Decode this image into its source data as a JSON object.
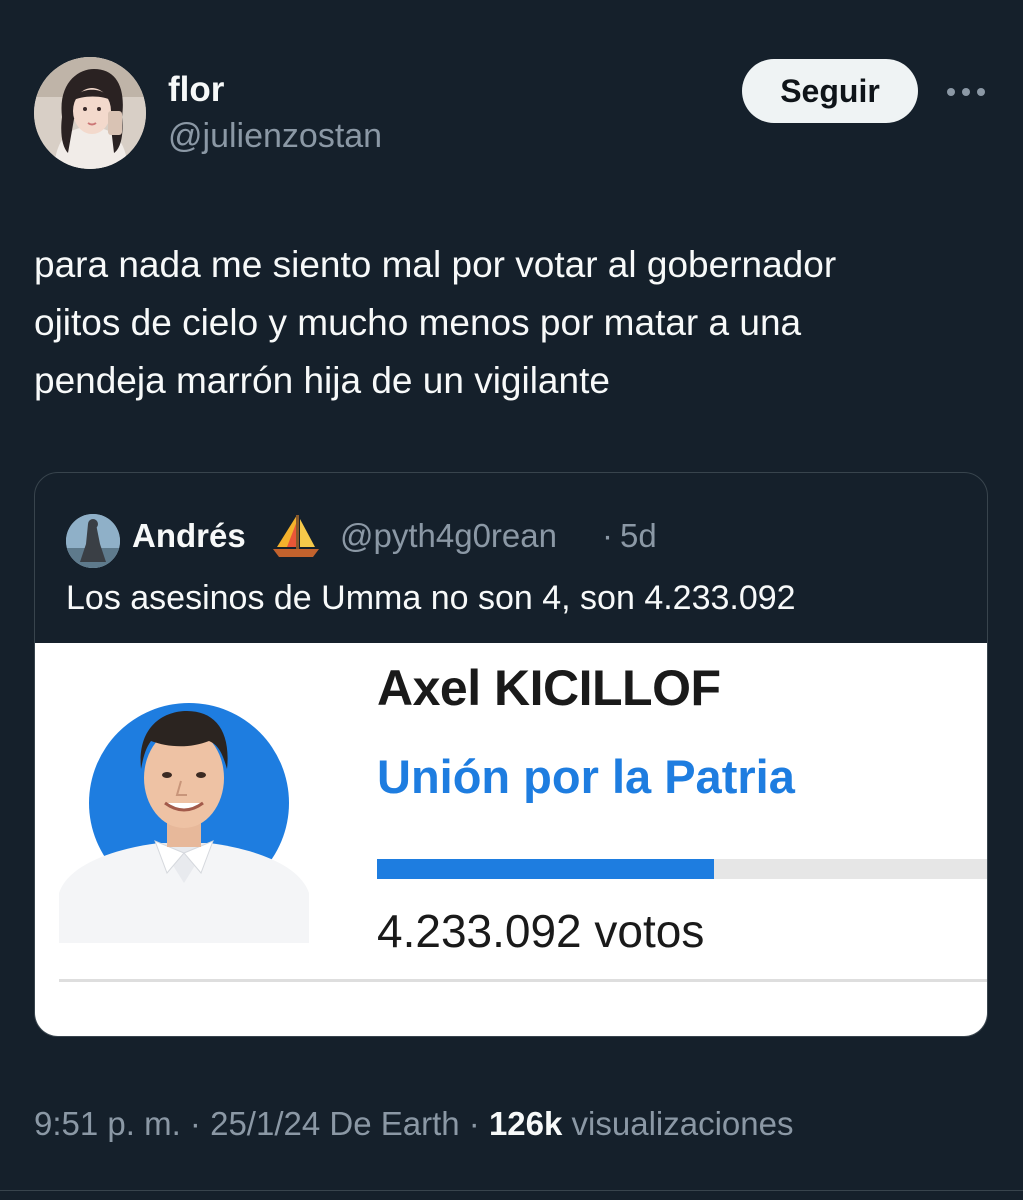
{
  "tweet": {
    "author": {
      "display_name": "flor",
      "handle": "@julienzostan",
      "avatar_icon": "user-avatar-photo"
    },
    "follow_label": "Seguir",
    "more_icon": "more-horizontal-icon",
    "text_lines": [
      "para nada me siento mal por votar al gobernador",
      "ojitos de cielo y mucho menos por matar a una",
      "pendeja marrón hija de un vigilante"
    ],
    "meta": {
      "time": "9:51 p. m.",
      "date": "25/1/24",
      "source": "De Earth",
      "views_count": "126k",
      "views_label": "visualizaciones",
      "separator": "·"
    }
  },
  "quote": {
    "author": {
      "display_name": "Andrés",
      "emoji_icon": "sailboat-emoji",
      "handle": "@pyth4g0rean",
      "separator": "·",
      "time": "5d"
    },
    "text": "Los asesinos de Umma no son 4, son 4.233.092",
    "media": {
      "candidate_name": "Axel KICILLOF",
      "party": "Unión por la Patria",
      "votes_label": "4.233.092 votos",
      "vote_share": 0.55,
      "bar_color": "#1e7de0",
      "photo_icon": "candidate-photo"
    }
  },
  "colors": {
    "background": "#15202b",
    "text_primary": "#f7f9f9",
    "text_secondary": "#8b98a5",
    "border": "#38444d",
    "party_blue": "#1e7de0"
  }
}
